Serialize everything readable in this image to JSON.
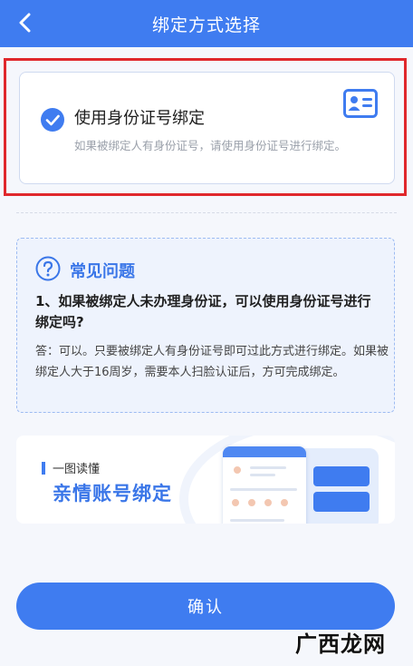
{
  "header": {
    "title": "绑定方式选择",
    "back_icon": "chevron-left-icon"
  },
  "option": {
    "title": "使用身份证号绑定",
    "description": "如果被绑定人有身份证号，请使用身份证号进行绑定。",
    "selected": true,
    "icon": "id-card-icon"
  },
  "faq": {
    "title": "常见问题",
    "question": "1、如果被绑定人未办理身份证，可以使用身份证号进行绑定吗?",
    "answer": "答：可以。只要被绑定人有身份证号即可过此方式进行绑定。如果被绑定人大于16周岁，需要本人扫脸认证后，方可完成绑定。"
  },
  "banner": {
    "tag": "一图读懂",
    "title": "亲情账号绑定"
  },
  "confirm_label": "确认",
  "watermark": {
    "text": "广西龙网"
  },
  "colors": {
    "primary": "#3f7cf0",
    "highlight_border": "#e0282c",
    "faq_background": "#eef3fd"
  }
}
